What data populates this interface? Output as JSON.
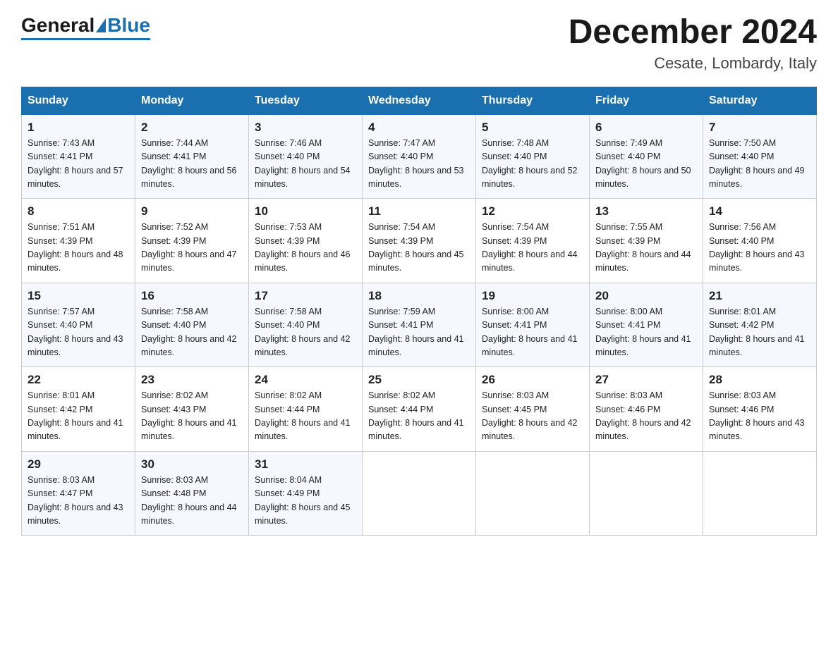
{
  "header": {
    "logo_general": "General",
    "logo_blue": "Blue",
    "month_title": "December 2024",
    "location": "Cesate, Lombardy, Italy"
  },
  "weekdays": [
    "Sunday",
    "Monday",
    "Tuesday",
    "Wednesday",
    "Thursday",
    "Friday",
    "Saturday"
  ],
  "weeks": [
    [
      {
        "day": "1",
        "sunrise": "7:43 AM",
        "sunset": "4:41 PM",
        "daylight": "8 hours and 57 minutes."
      },
      {
        "day": "2",
        "sunrise": "7:44 AM",
        "sunset": "4:41 PM",
        "daylight": "8 hours and 56 minutes."
      },
      {
        "day": "3",
        "sunrise": "7:46 AM",
        "sunset": "4:40 PM",
        "daylight": "8 hours and 54 minutes."
      },
      {
        "day": "4",
        "sunrise": "7:47 AM",
        "sunset": "4:40 PM",
        "daylight": "8 hours and 53 minutes."
      },
      {
        "day": "5",
        "sunrise": "7:48 AM",
        "sunset": "4:40 PM",
        "daylight": "8 hours and 52 minutes."
      },
      {
        "day": "6",
        "sunrise": "7:49 AM",
        "sunset": "4:40 PM",
        "daylight": "8 hours and 50 minutes."
      },
      {
        "day": "7",
        "sunrise": "7:50 AM",
        "sunset": "4:40 PM",
        "daylight": "8 hours and 49 minutes."
      }
    ],
    [
      {
        "day": "8",
        "sunrise": "7:51 AM",
        "sunset": "4:39 PM",
        "daylight": "8 hours and 48 minutes."
      },
      {
        "day": "9",
        "sunrise": "7:52 AM",
        "sunset": "4:39 PM",
        "daylight": "8 hours and 47 minutes."
      },
      {
        "day": "10",
        "sunrise": "7:53 AM",
        "sunset": "4:39 PM",
        "daylight": "8 hours and 46 minutes."
      },
      {
        "day": "11",
        "sunrise": "7:54 AM",
        "sunset": "4:39 PM",
        "daylight": "8 hours and 45 minutes."
      },
      {
        "day": "12",
        "sunrise": "7:54 AM",
        "sunset": "4:39 PM",
        "daylight": "8 hours and 44 minutes."
      },
      {
        "day": "13",
        "sunrise": "7:55 AM",
        "sunset": "4:39 PM",
        "daylight": "8 hours and 44 minutes."
      },
      {
        "day": "14",
        "sunrise": "7:56 AM",
        "sunset": "4:40 PM",
        "daylight": "8 hours and 43 minutes."
      }
    ],
    [
      {
        "day": "15",
        "sunrise": "7:57 AM",
        "sunset": "4:40 PM",
        "daylight": "8 hours and 43 minutes."
      },
      {
        "day": "16",
        "sunrise": "7:58 AM",
        "sunset": "4:40 PM",
        "daylight": "8 hours and 42 minutes."
      },
      {
        "day": "17",
        "sunrise": "7:58 AM",
        "sunset": "4:40 PM",
        "daylight": "8 hours and 42 minutes."
      },
      {
        "day": "18",
        "sunrise": "7:59 AM",
        "sunset": "4:41 PM",
        "daylight": "8 hours and 41 minutes."
      },
      {
        "day": "19",
        "sunrise": "8:00 AM",
        "sunset": "4:41 PM",
        "daylight": "8 hours and 41 minutes."
      },
      {
        "day": "20",
        "sunrise": "8:00 AM",
        "sunset": "4:41 PM",
        "daylight": "8 hours and 41 minutes."
      },
      {
        "day": "21",
        "sunrise": "8:01 AM",
        "sunset": "4:42 PM",
        "daylight": "8 hours and 41 minutes."
      }
    ],
    [
      {
        "day": "22",
        "sunrise": "8:01 AM",
        "sunset": "4:42 PM",
        "daylight": "8 hours and 41 minutes."
      },
      {
        "day": "23",
        "sunrise": "8:02 AM",
        "sunset": "4:43 PM",
        "daylight": "8 hours and 41 minutes."
      },
      {
        "day": "24",
        "sunrise": "8:02 AM",
        "sunset": "4:44 PM",
        "daylight": "8 hours and 41 minutes."
      },
      {
        "day": "25",
        "sunrise": "8:02 AM",
        "sunset": "4:44 PM",
        "daylight": "8 hours and 41 minutes."
      },
      {
        "day": "26",
        "sunrise": "8:03 AM",
        "sunset": "4:45 PM",
        "daylight": "8 hours and 42 minutes."
      },
      {
        "day": "27",
        "sunrise": "8:03 AM",
        "sunset": "4:46 PM",
        "daylight": "8 hours and 42 minutes."
      },
      {
        "day": "28",
        "sunrise": "8:03 AM",
        "sunset": "4:46 PM",
        "daylight": "8 hours and 43 minutes."
      }
    ],
    [
      {
        "day": "29",
        "sunrise": "8:03 AM",
        "sunset": "4:47 PM",
        "daylight": "8 hours and 43 minutes."
      },
      {
        "day": "30",
        "sunrise": "8:03 AM",
        "sunset": "4:48 PM",
        "daylight": "8 hours and 44 minutes."
      },
      {
        "day": "31",
        "sunrise": "8:04 AM",
        "sunset": "4:49 PM",
        "daylight": "8 hours and 45 minutes."
      },
      null,
      null,
      null,
      null
    ]
  ]
}
